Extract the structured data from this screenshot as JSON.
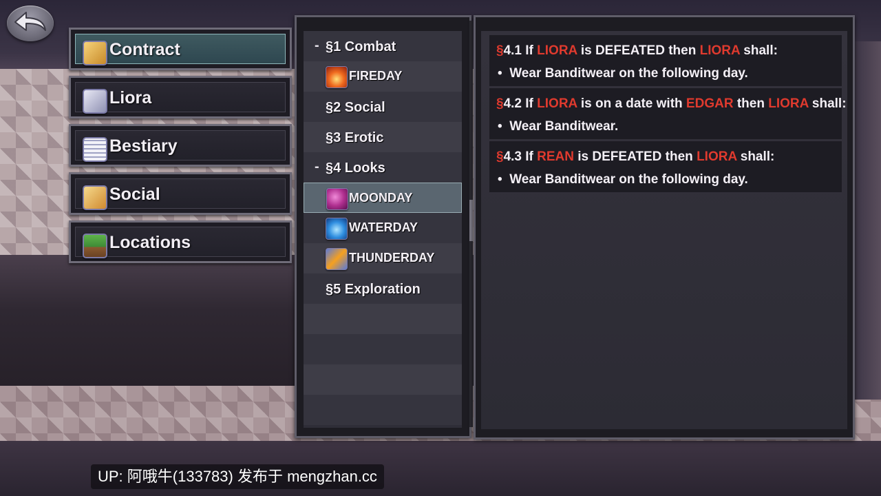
{
  "menu": {
    "items": [
      {
        "label": "Contract",
        "icon": "scroll-icon",
        "selected": true
      },
      {
        "label": "Liora",
        "icon": "card-icon",
        "selected": false
      },
      {
        "label": "Bestiary",
        "icon": "book-icon",
        "selected": false
      },
      {
        "label": "Social",
        "icon": "letter-icon",
        "selected": false
      },
      {
        "label": "Locations",
        "icon": "map-icon",
        "selected": false
      }
    ]
  },
  "sections": {
    "items": [
      {
        "prefix": "-",
        "label": "§1 Combat"
      },
      {
        "label": "FIREDAY",
        "icon": "fire-icon"
      },
      {
        "label": "§2 Social"
      },
      {
        "label": "§3 Erotic"
      },
      {
        "prefix": "-",
        "label": "§4 Looks"
      },
      {
        "label": "MOONDAY",
        "icon": "moon-icon",
        "selected": true
      },
      {
        "label": "WATERDAY",
        "icon": "water-icon"
      },
      {
        "label": "THUNDERDAY",
        "icon": "thunder-icon"
      },
      {
        "label": "§5 Exploration"
      }
    ]
  },
  "clauses": [
    {
      "head": [
        {
          "text": "§",
          "red": true
        },
        {
          "text": "4.1 If ",
          "red": false
        },
        {
          "text": "LIORA",
          "red": true
        },
        {
          "text": " is DEFEATED then ",
          "red": false
        },
        {
          "text": "LIORA",
          "red": true
        },
        {
          "text": " shall:",
          "red": false
        }
      ],
      "bullet_mark": "•",
      "bullet": "Wear Banditwear on the following day."
    },
    {
      "head": [
        {
          "text": "§",
          "red": true
        },
        {
          "text": "4.2 If ",
          "red": false
        },
        {
          "text": "LIORA",
          "red": true
        },
        {
          "text": " is on a date with ",
          "red": false
        },
        {
          "text": "EDGAR",
          "red": true
        },
        {
          "text": " then ",
          "red": false
        },
        {
          "text": "LIORA",
          "red": true
        },
        {
          "text": " shall:",
          "red": false
        }
      ],
      "bullet_mark": "•",
      "bullet": "Wear Banditwear."
    },
    {
      "head": [
        {
          "text": "§",
          "red": true
        },
        {
          "text": "4.3 If ",
          "red": false
        },
        {
          "text": "REAN",
          "red": true
        },
        {
          "text": " is DEFEATED then ",
          "red": false
        },
        {
          "text": "LIORA",
          "red": true
        },
        {
          "text": " shall:",
          "red": false
        }
      ],
      "bullet_mark": "•",
      "bullet": "Wear Banditwear on the following day."
    }
  ],
  "colors": {
    "highlight_red": "#e03a2e",
    "selected_menu": "#3f5a60"
  },
  "watermark": "UP: 阿哦牛(133783) 发布于 mengzhan.cc"
}
